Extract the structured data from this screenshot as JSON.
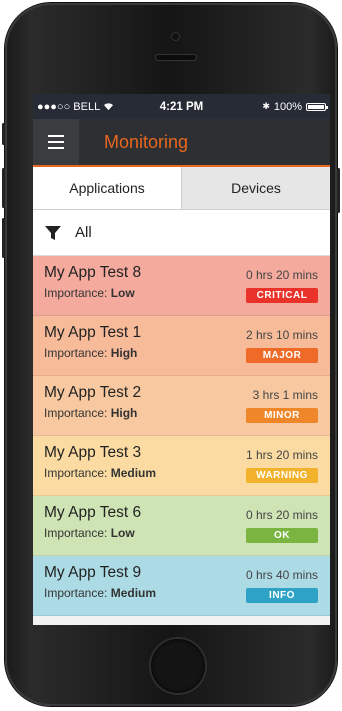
{
  "status_bar": {
    "carrier": "●●●○○ BELL",
    "time": "4:21 PM",
    "bluetooth": "✱",
    "battery_percent": "100%"
  },
  "app_bar": {
    "title": "Monitoring",
    "menu_icon": "hamburger-menu-icon"
  },
  "tabs": [
    {
      "label": "Applications",
      "active": true
    },
    {
      "label": "Devices",
      "active": false
    }
  ],
  "filter": {
    "icon": "funnel-icon",
    "label": "All"
  },
  "importance_prefix": "Importance:",
  "apps": [
    {
      "name": "My App Test 8",
      "importance": "Low",
      "duration": "0 hrs 20 mins",
      "status": "CRITICAL",
      "row_color": "#f5aa9e",
      "badge_color": "#e8322a"
    },
    {
      "name": "My App Test 1",
      "importance": "High",
      "duration": "2 hrs 10 mins",
      "status": "MAJOR",
      "row_color": "#f7bb9a",
      "badge_color": "#ee6a26"
    },
    {
      "name": "My App Test 2",
      "importance": "High",
      "duration": "3 hrs 1 mins",
      "status": "MINOR",
      "row_color": "#f8c9a0",
      "badge_color": "#f0862a"
    },
    {
      "name": "My App Test 3",
      "importance": "Medium",
      "duration": "1 hrs 20 mins",
      "status": "WARNING",
      "row_color": "#fbdba2",
      "badge_color": "#f2b22c"
    },
    {
      "name": "My App Test 6",
      "importance": "Low",
      "duration": "0 hrs 20 mins",
      "status": "OK",
      "row_color": "#cfe4b4",
      "badge_color": "#7ab542"
    },
    {
      "name": "My App Test 9",
      "importance": "Medium",
      "duration": "0 hrs 40 mins",
      "status": "INFO",
      "row_color": "#acdbe5",
      "badge_color": "#2fa3c6"
    }
  ]
}
